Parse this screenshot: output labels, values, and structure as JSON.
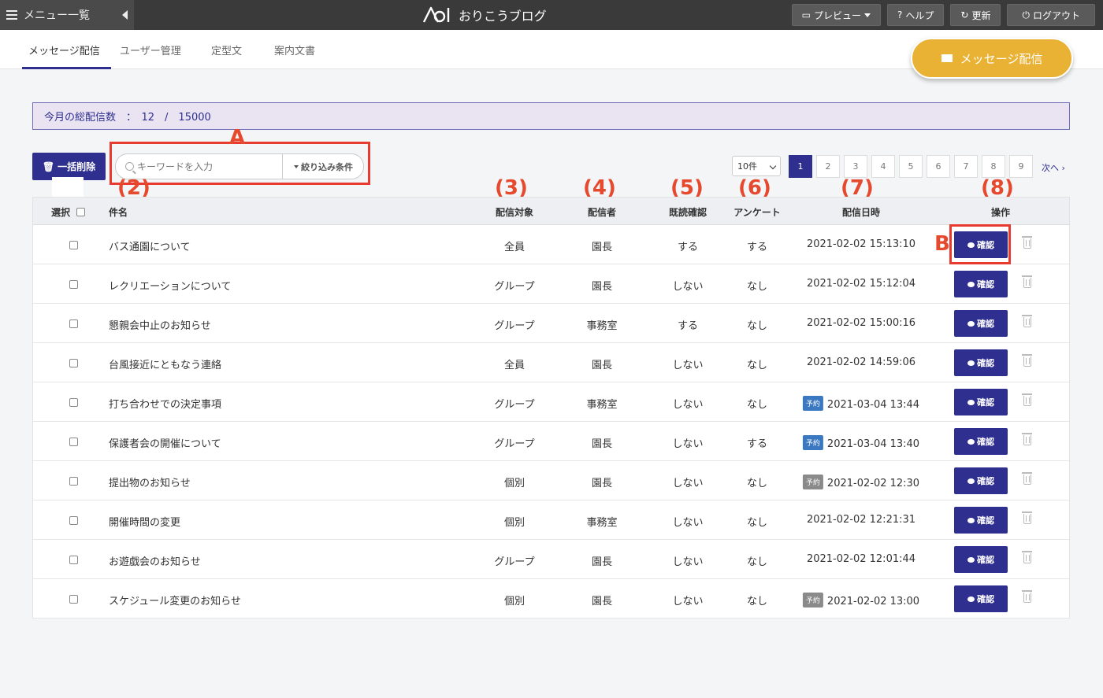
{
  "topbar": {
    "menu_label": "メニュー一覧",
    "brand": "おりこうブログ",
    "actions": [
      {
        "label": "プレビュー",
        "icon": "monitor-icon"
      },
      {
        "label": "ヘルプ",
        "icon": "help-icon"
      },
      {
        "label": "更新",
        "icon": "refresh-icon"
      },
      {
        "label": "ログアウト",
        "icon": "power-icon"
      }
    ]
  },
  "tabs": [
    "メッセージ配信",
    "ユーザー管理",
    "定型文",
    "案内文書"
  ],
  "primary_button": "メッセージ配信",
  "summary": "今月の総配信数　：　12　/　15000",
  "toolbar": {
    "bulk_delete": "一括削除",
    "search_placeholder": "キーワードを入力",
    "filter_label": "絞り込み条件",
    "per_page": "10件",
    "pages": [
      "1",
      "2",
      "3",
      "4",
      "5",
      "6",
      "7",
      "8",
      "9"
    ],
    "active_page": "1",
    "next_label": "次へ ›"
  },
  "table": {
    "headers": {
      "select": "選択",
      "subject": "件名",
      "target": "配信対象",
      "sender": "配信者",
      "read_check": "既読確認",
      "survey": "アンケート",
      "datetime": "配信日時",
      "actions": "操作"
    },
    "confirm_label": "確認",
    "badge_colors": {
      "scheduled": "#3a78c2",
      "past": "#8a8a8a"
    },
    "rows": [
      {
        "subject": "バス通園について",
        "target": "全員",
        "sender": "園長",
        "read": "する",
        "survey": "する",
        "datetime": "2021-02-02 15:13:10",
        "badge": ""
      },
      {
        "subject": "レクリエーションについて",
        "target": "グループ",
        "sender": "園長",
        "read": "しない",
        "survey": "なし",
        "datetime": "2021-02-02 15:12:04",
        "badge": ""
      },
      {
        "subject": "懇親会中止のお知らせ",
        "target": "グループ",
        "sender": "事務室",
        "read": "する",
        "survey": "なし",
        "datetime": "2021-02-02 15:00:16",
        "badge": ""
      },
      {
        "subject": "台風接近にともなう連絡",
        "target": "全員",
        "sender": "園長",
        "read": "しない",
        "survey": "なし",
        "datetime": "2021-02-02 14:59:06",
        "badge": ""
      },
      {
        "subject": "打ち合わせでの決定事項",
        "target": "グループ",
        "sender": "事務室",
        "read": "しない",
        "survey": "なし",
        "datetime": "2021-03-04 13:44",
        "badge": "予約",
        "badge_type": "scheduled"
      },
      {
        "subject": "保護者会の開催について",
        "target": "グループ",
        "sender": "園長",
        "read": "しない",
        "survey": "する",
        "datetime": "2021-03-04 13:40",
        "badge": "予約",
        "badge_type": "scheduled"
      },
      {
        "subject": "提出物のお知らせ",
        "target": "個別",
        "sender": "園長",
        "read": "しない",
        "survey": "なし",
        "datetime": "2021-02-02 12:30",
        "badge": "予約",
        "badge_type": "past"
      },
      {
        "subject": "開催時間の変更",
        "target": "個別",
        "sender": "事務室",
        "read": "しない",
        "survey": "なし",
        "datetime": "2021-02-02 12:21:31",
        "badge": ""
      },
      {
        "subject": "お遊戯会のお知らせ",
        "target": "グループ",
        "sender": "園長",
        "read": "しない",
        "survey": "なし",
        "datetime": "2021-02-02 12:01:44",
        "badge": ""
      },
      {
        "subject": "スケジュール変更のお知らせ",
        "target": "個別",
        "sender": "園長",
        "read": "しない",
        "survey": "なし",
        "datetime": "2021-02-02 13:00",
        "badge": "予約",
        "badge_type": "past"
      }
    ]
  },
  "annotations": {
    "a": "A",
    "b": "B",
    "n2": "(2)",
    "n3": "(3)",
    "n4": "(4)",
    "n5": "(5)",
    "n6": "(6)",
    "n7": "(7)",
    "n8": "(8)"
  },
  "colors": {
    "primary": "#2e2f8f",
    "accent": "#e9b234",
    "annotation": "#e64a2e"
  }
}
